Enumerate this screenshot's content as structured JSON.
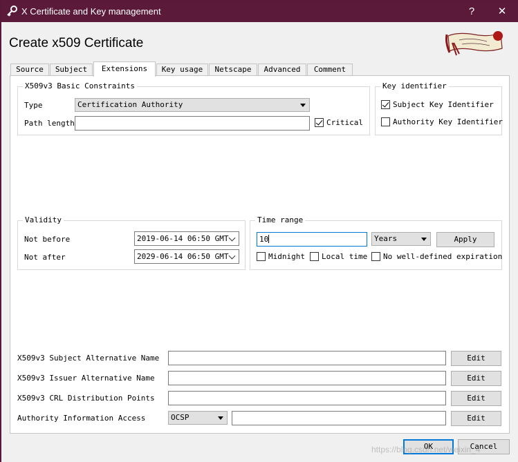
{
  "window": {
    "title": "X Certificate and Key management",
    "help_label": "?",
    "close_label": "✕"
  },
  "heading": "Create x509 Certificate",
  "tabs": [
    {
      "label": "Source"
    },
    {
      "label": "Subject"
    },
    {
      "label": "Extensions"
    },
    {
      "label": "Key usage"
    },
    {
      "label": "Netscape"
    },
    {
      "label": "Advanced"
    },
    {
      "label": "Comment"
    }
  ],
  "basic_constraints": {
    "title": "X509v3 Basic Constraints",
    "type_label": "Type",
    "type_value": "Certification Authority",
    "path_length_label": "Path length",
    "path_length_value": "",
    "critical_label": "Critical",
    "critical_checked": true
  },
  "key_identifier": {
    "title": "Key identifier",
    "subject_label": "Subject Key Identifier",
    "subject_checked": true,
    "authority_label": "Authority Key Identifier",
    "authority_checked": false
  },
  "validity": {
    "title": "Validity",
    "not_before_label": "Not before",
    "not_before_value": "2019-06-14 06:50 GMT",
    "not_after_label": "Not after",
    "not_after_value": "2029-06-14 06:50 GMT"
  },
  "time_range": {
    "title": "Time range",
    "value": "10",
    "unit": "Years",
    "apply_label": "Apply",
    "midnight_label": "Midnight",
    "local_time_label": "Local time",
    "no_expiration_label": "No well-defined expiration"
  },
  "extensions": {
    "san_label": "X509v3 Subject Alternative Name",
    "ian_label": "X509v3 Issuer Alternative Name",
    "crl_label": "X509v3 CRL Distribution Points",
    "aia_label": "Authority Information Access",
    "aia_method": "OCSP",
    "edit_label": "Edit"
  },
  "footer": {
    "ok_label": "OK",
    "cancel_label": "Cancel",
    "watermark": "https://blog.csdn.net/weixin_4"
  }
}
